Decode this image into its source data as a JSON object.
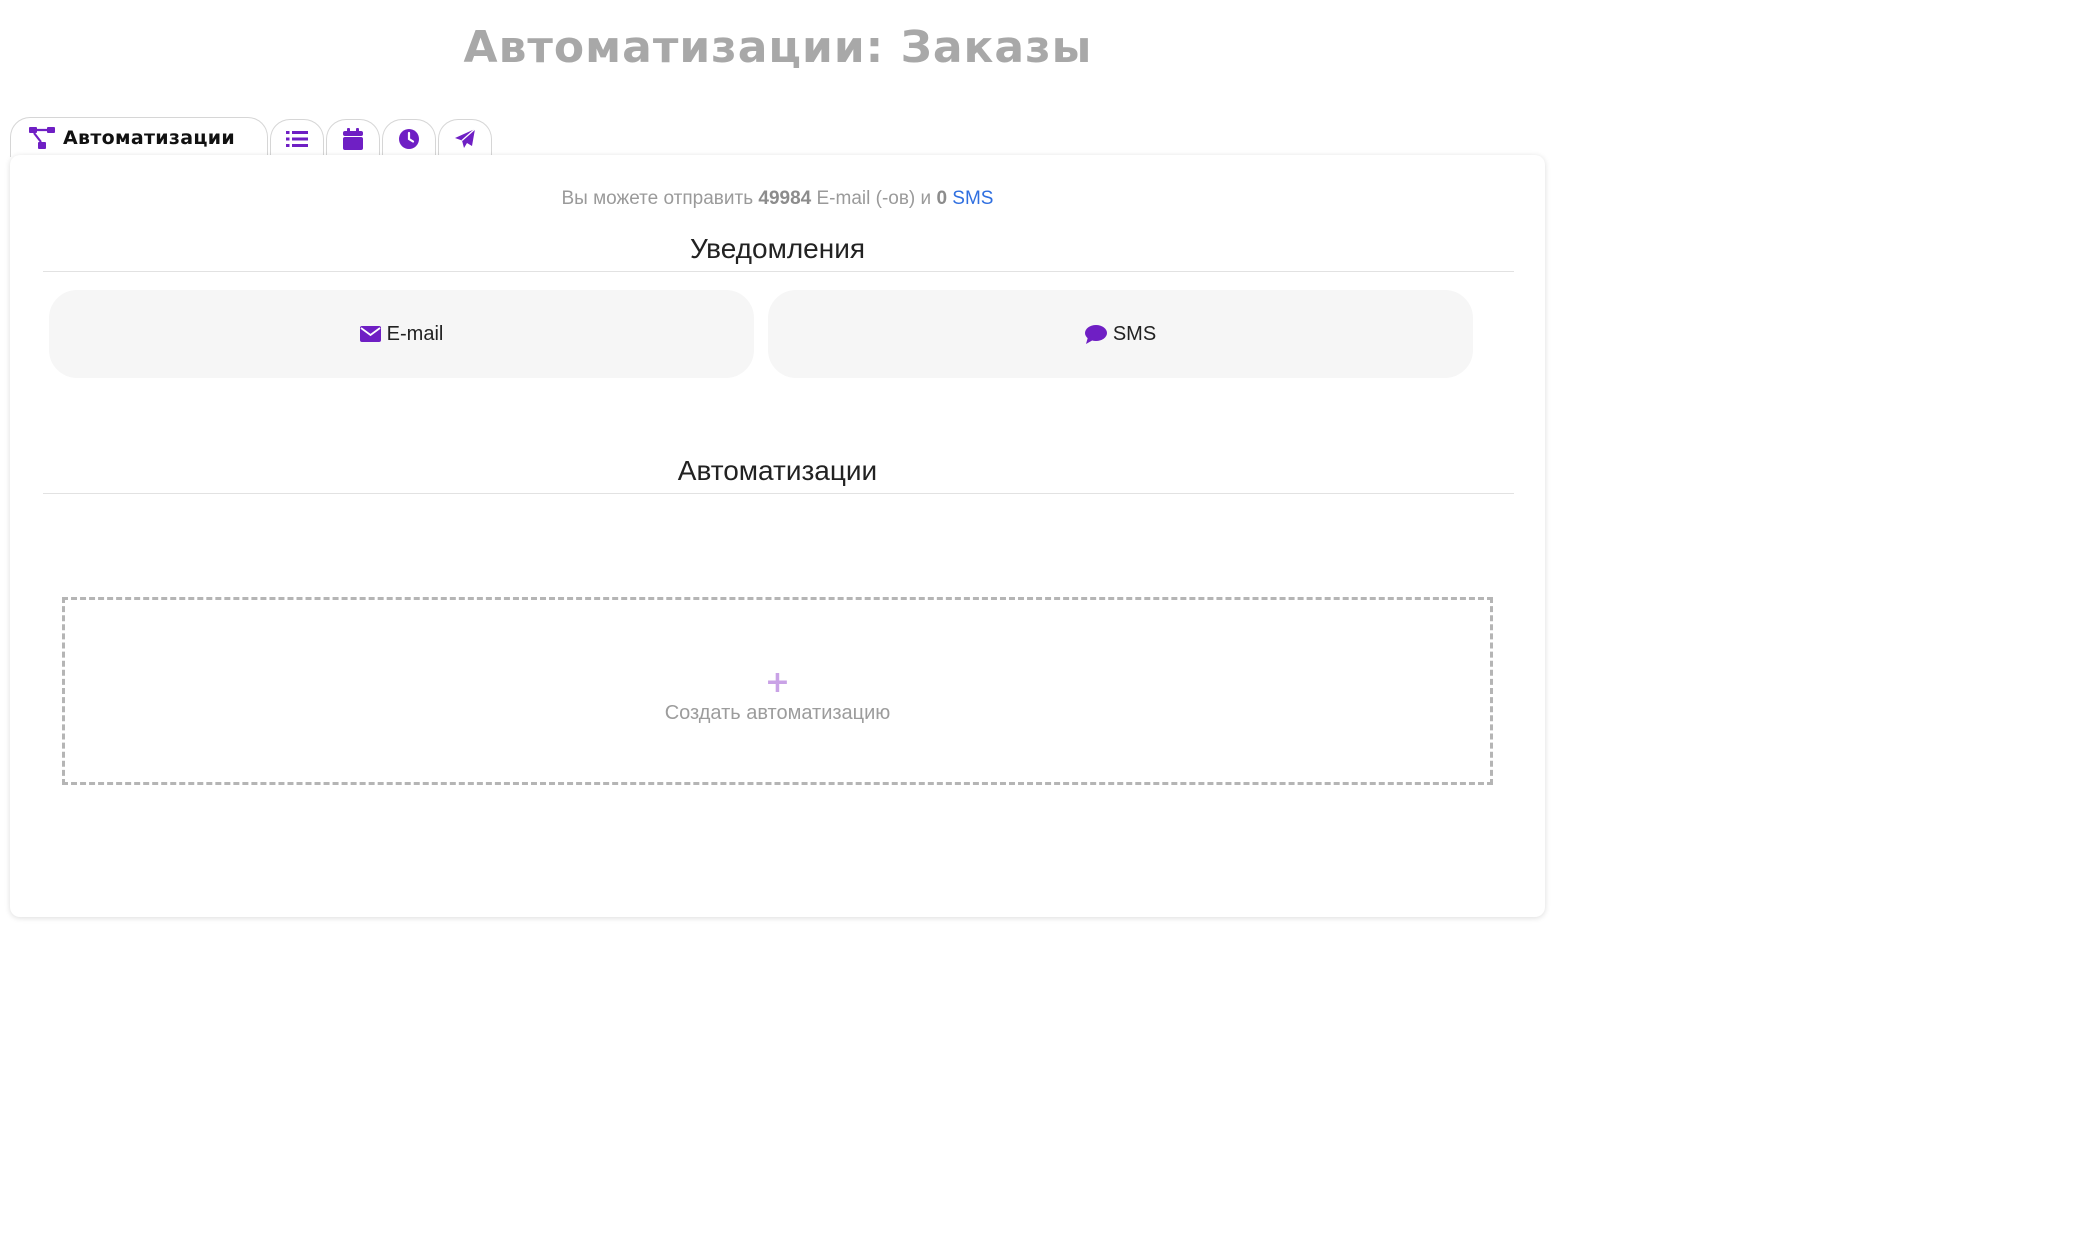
{
  "page": {
    "title": "Автоматизации: Заказы"
  },
  "tabs": [
    {
      "label": "Автоматизации",
      "icon": "sitemap-icon",
      "active": true
    },
    {
      "icon": "list-icon"
    },
    {
      "icon": "calendar-icon"
    },
    {
      "icon": "clock-icon"
    },
    {
      "icon": "paper-plane-icon"
    }
  ],
  "quota": {
    "prefix": "Вы можете отправить",
    "email_count": "49984",
    "email_unit": "E-mail (-ов) и",
    "sms_count": "0",
    "sms_label": "SMS"
  },
  "notifications": {
    "title": "Уведомления",
    "email_label": "E-mail",
    "sms_label": "SMS"
  },
  "automations": {
    "title": "Автоматизации",
    "create_label": "Создать автоматизацию"
  },
  "colors": {
    "accent": "#6f1fc4",
    "title_gray": "#a8a8a8",
    "link_blue": "#2f6fe0",
    "plus_light": "#c9a2e6"
  }
}
